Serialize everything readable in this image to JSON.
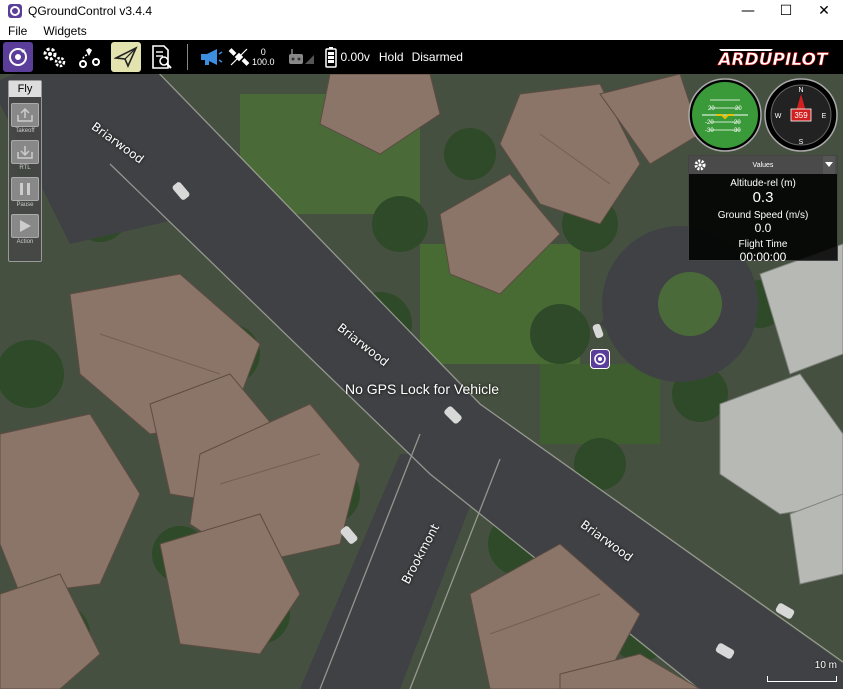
{
  "window": {
    "title": "QGroundControl v3.4.4",
    "minimize": "—",
    "maximize": "☐",
    "close": "✕"
  },
  "menu": [
    "File",
    "Widgets"
  ],
  "toolbar": {
    "buttons": [
      {
        "name": "qgc-logo-button",
        "icon": "qgc-logo-icon"
      },
      {
        "name": "settings-button",
        "icon": "gears-icon"
      },
      {
        "name": "plan-button",
        "icon": "waypoint-path-icon"
      },
      {
        "name": "fly-button",
        "icon": "paper-plane-icon"
      },
      {
        "name": "analyze-button",
        "icon": "document-search-icon"
      }
    ],
    "gps_count": "0",
    "gps_hdop": "100.0",
    "battery": "0.00v",
    "flight_mode": "Hold",
    "arm_state": "Disarmed",
    "brand": "ARDUPILOT"
  },
  "fly_panel": {
    "title": "Fly",
    "buttons": [
      {
        "label": "Takeoff",
        "icon": "takeoff-icon"
      },
      {
        "label": "RTL",
        "icon": "rtl-icon"
      },
      {
        "label": "Pause",
        "icon": "pause-icon"
      },
      {
        "label": "Action",
        "icon": "play-icon"
      }
    ]
  },
  "instruments": {
    "attitude_marks": [
      "20",
      "20",
      "-20",
      "-20",
      "-30",
      "-30"
    ],
    "compass_heading": "359",
    "compass_letters": [
      "N",
      "E",
      "S",
      "W"
    ],
    "values_title": "Values",
    "values": [
      {
        "label": "Altitude-rel (m)",
        "value": "0.3"
      },
      {
        "label": "Ground Speed (m/s)",
        "value": "0.0"
      },
      {
        "label": "Flight Time",
        "value": "00:00:00"
      }
    ]
  },
  "map": {
    "message": "No GPS Lock for Vehicle",
    "streets": [
      "Briarwood",
      "Briarwood",
      "Briarwood",
      "Brookmont"
    ],
    "scale_label": "10 m"
  },
  "colors": {
    "accent": "#5a3e9a",
    "active_tool": "#e3e3b0",
    "attitude_green": "#3a9a3a"
  }
}
